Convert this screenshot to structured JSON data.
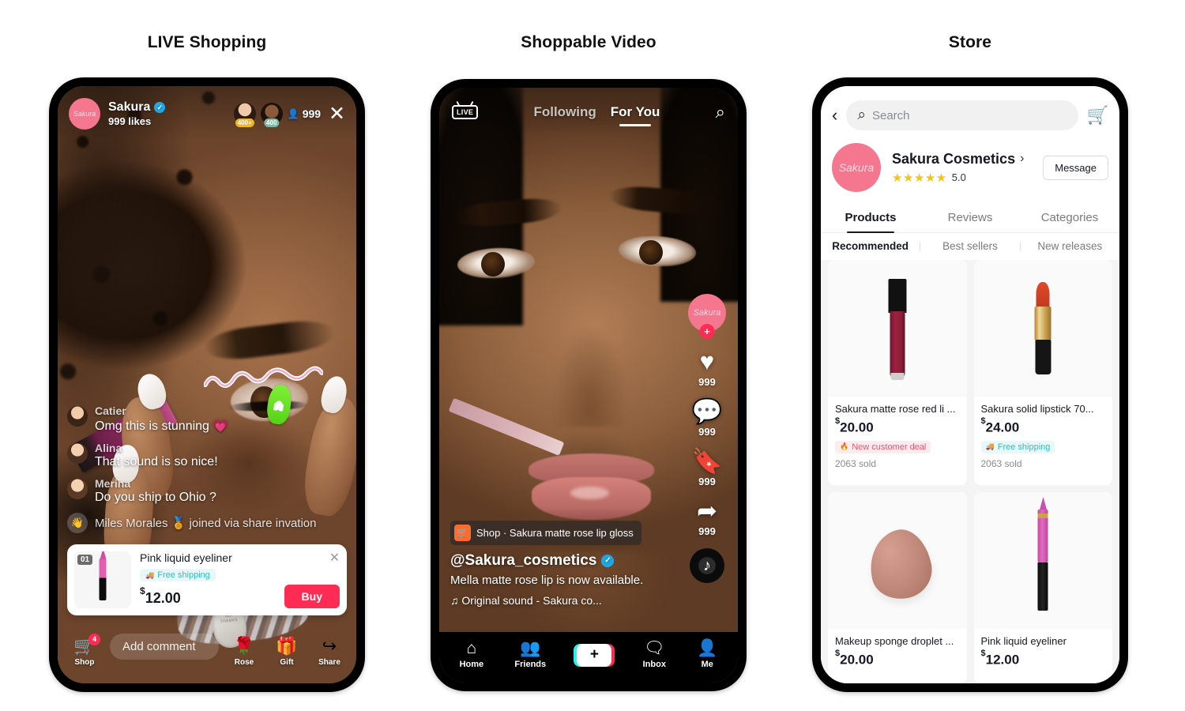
{
  "columns": [
    {
      "title": "LIVE Shopping"
    },
    {
      "title": "Shoppable Video"
    },
    {
      "title": "Store"
    }
  ],
  "live": {
    "host": {
      "avatar_label": "Sakura",
      "name": "Sakura",
      "verified_glyph": "✓",
      "likes": "999 likes"
    },
    "viewers": [
      {
        "badge": "400+"
      },
      {
        "badge": "400"
      }
    ],
    "viewer_icon": "👤",
    "viewer_count": "999",
    "close_glyph": "✕",
    "comments": [
      {
        "name": "Catier",
        "text": "Omg this is stunning 💗"
      },
      {
        "name": "Alina",
        "text": "That sound is so nice!"
      },
      {
        "name": "Merina",
        "text": "Do you ship to Ohio ?"
      }
    ],
    "join_notice": {
      "icon": "👋",
      "text": "Miles Morales 🏅 joined via share invation"
    },
    "product": {
      "rank": "01",
      "title": "Pink liquid eyeliner",
      "shipping_icon": "🚚",
      "shipping_label": "Free shipping",
      "currency": "$",
      "price": "12.00",
      "buy_label": "Buy",
      "close_glyph": "✕"
    },
    "bottom": {
      "shop_icon": "🛒",
      "shop_label": "Shop",
      "shop_badge": "4",
      "comment_placeholder": "Add comment",
      "actions": [
        {
          "icon": "🌹",
          "label": "Rose"
        },
        {
          "icon": "🎁",
          "label": "Gift"
        },
        {
          "icon": "↪",
          "label": "Share"
        }
      ]
    }
  },
  "video": {
    "live_badge": "LIVE",
    "tabs": [
      {
        "label": "Following",
        "active": false
      },
      {
        "label": "For You",
        "active": true
      }
    ],
    "search_glyph": "⌕",
    "rail": {
      "avatar_label": "Sakura",
      "plus_glyph": "+",
      "items": [
        {
          "icon": "♥",
          "count": "999",
          "name": "like"
        },
        {
          "icon": "💬",
          "count": "999",
          "name": "comment"
        },
        {
          "icon": "🔖",
          "count": "999",
          "name": "bookmark"
        },
        {
          "icon": "➦",
          "count": "999",
          "name": "share"
        }
      ],
      "disc_glyph": "♪"
    },
    "shop_tag": {
      "icon": "🛒",
      "text": "Shop · Sakura matte rose lip gloss"
    },
    "username": "@Sakura_cosmetics",
    "verified_glyph": "✓",
    "description": "Mella matte rose lip is now available.",
    "sound": "♫  Original sound - Sakura co...",
    "nav": [
      {
        "icon": "⌂",
        "label": "Home",
        "name": "home"
      },
      {
        "icon": "👥",
        "label": "Friends",
        "name": "friends"
      },
      {
        "icon": "+",
        "label": "",
        "name": "create"
      },
      {
        "icon": "🗨",
        "label": "Inbox",
        "name": "inbox"
      },
      {
        "icon": "👤",
        "label": "Me",
        "name": "me"
      }
    ]
  },
  "store": {
    "back_glyph": "‹",
    "search_icon": "⌕",
    "search_placeholder": "Search",
    "cart_icon": "🛒",
    "shop": {
      "avatar_label": "Sakura",
      "name": "Sakura Cosmetics",
      "chevron": "›",
      "stars": "★★★★★",
      "rating": "5.0",
      "message_label": "Message"
    },
    "tabs": [
      {
        "label": "Products",
        "active": true
      },
      {
        "label": "Reviews",
        "active": false
      },
      {
        "label": "Categories",
        "active": false
      }
    ],
    "subtabs": [
      {
        "label": "Recommended",
        "active": true
      },
      {
        "label": "Best sellers",
        "active": false
      },
      {
        "label": "New releases",
        "active": false
      }
    ],
    "products": [
      {
        "art": "gloss",
        "title": "Sakura matte rose red li ...",
        "currency": "$",
        "price": "20.00",
        "pill_type": "deal",
        "pill_icon": "🔥",
        "pill_label": "New customer deal",
        "sold": "2063 sold"
      },
      {
        "art": "lipstick",
        "title": "Sakura solid lipstick 70...",
        "currency": "$",
        "price": "24.00",
        "pill_type": "ship",
        "pill_icon": "🚚",
        "pill_label": "Free shipping",
        "sold": "2063 sold"
      },
      {
        "art": "sponge",
        "title": "Makeup sponge droplet ...",
        "currency": "$",
        "price": "20.00",
        "pill_type": "",
        "pill_icon": "",
        "pill_label": "",
        "sold": ""
      },
      {
        "art": "eyeliner",
        "title": "Pink liquid eyeliner",
        "currency": "$",
        "price": "12.00",
        "pill_type": "",
        "pill_icon": "",
        "pill_label": "",
        "sold": ""
      }
    ]
  },
  "colors": {
    "accent_pink": "#fe2c55",
    "brand_avatar": "#f4778f",
    "teal_pill": "#2ec0c4",
    "star_gold": "#ffc300",
    "verified_blue": "#20a9e8"
  }
}
